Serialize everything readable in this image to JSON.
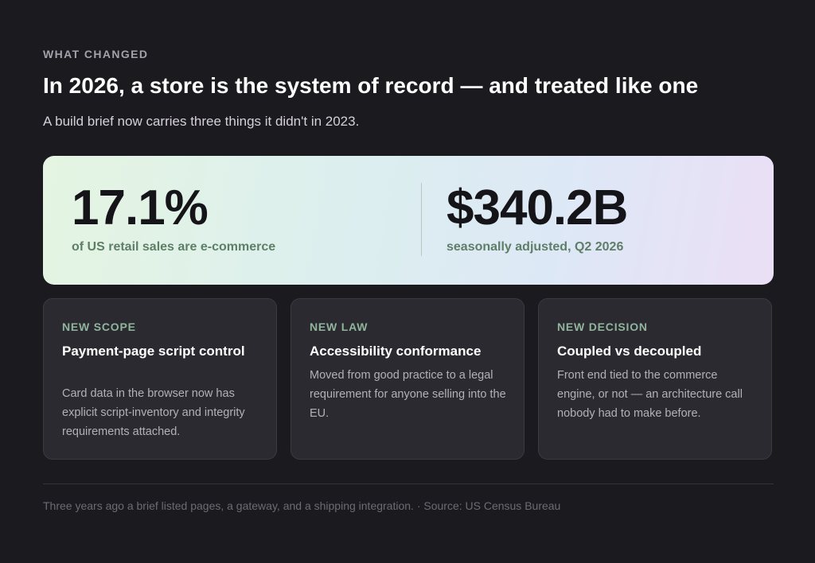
{
  "header": {
    "eyebrow": "WHAT CHANGED",
    "title": "In 2026, a store is the system of record — and treated like one",
    "subtitle": "A build brief now carries three things it didn't in 2023."
  },
  "stats": [
    {
      "value": "17.1%",
      "caption": "of US retail sales are e-commerce"
    },
    {
      "value": "$340.2B",
      "caption": "seasonally adjusted, Q2 2026"
    }
  ],
  "cards": [
    {
      "tag": "NEW SCOPE",
      "title": "Payment-page script control",
      "body": "Card data in the browser now has explicit script-inventory and integrity requirements attached."
    },
    {
      "tag": "NEW LAW",
      "title": "Accessibility conformance",
      "body": "Moved from good practice to a legal requirement for anyone selling into the EU."
    },
    {
      "tag": "NEW DECISION",
      "title": "Coupled vs decoupled",
      "body": "Front end tied to the commerce engine, or not — an architecture call nobody had to make before."
    }
  ],
  "footer": {
    "note": "Three years ago a brief listed pages, a gateway, and a shipping integration. · Source: US Census Bureau"
  },
  "colors": {
    "background": "#1b1a1f",
    "card_background": "#2b2a30",
    "tag_accent": "#90b49d",
    "stat_caption": "#5e7e67"
  }
}
